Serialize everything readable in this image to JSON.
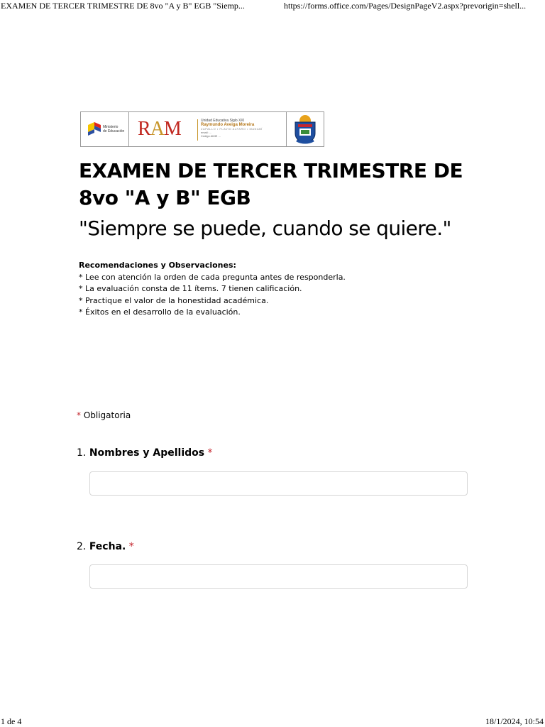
{
  "print_header": {
    "title": "EXAMEN DE TERCER TRIMESTRE DE 8vo \"A y B\" EGB \"Siemp...",
    "url": "https://forms.office.com/Pages/DesignPageV2.aspx?prevorigin=shell..."
  },
  "banner": {
    "ministry_line1": "Ministerio",
    "ministry_line2": "de Educación",
    "ram_r": "R",
    "ram_a": "A",
    "ram_m": "M",
    "school_line1": "Unidad Educativa Siglo XXI",
    "school_line2": "Raymundo Aveiga Moreira",
    "school_line3": "ZAPALLO • FLAVIO ALFARO • MANABÍ",
    "school_line4": "email: ...",
    "school_line5": "Código AMIE ..."
  },
  "form": {
    "title": "EXAMEN DE TERCER TRIMESTRE DE 8vo \"A y B\" EGB",
    "subtitle": "\"Siempre se puede, cuando se quiere.\"",
    "recommendations_heading": "Recomendaciones y Observaciones:",
    "recommendations": [
      "* Lee con atención la orden de cada pregunta antes de responderla.",
      "* La evaluación consta de 11 ítems.  7 tienen calificación.",
      "* Practique el valor de la honestidad académica.",
      "* Éxitos en el desarrollo de la evaluación."
    ],
    "required_star": "*",
    "required_label": "Obligatoria",
    "questions": [
      {
        "number": "1.",
        "label": "Nombres y Apellidos",
        "required": "*",
        "value": ""
      },
      {
        "number": "2.",
        "label": "Fecha.",
        "required": "*",
        "value": ""
      }
    ]
  },
  "print_footer": {
    "page": "1 de 4",
    "datetime": "18/1/2024, 10:54"
  },
  "colors": {
    "required": "#c4262e",
    "input_border": "#d6d6d6",
    "ram_red": "#c0271f",
    "ram_gold": "#c8962a"
  }
}
